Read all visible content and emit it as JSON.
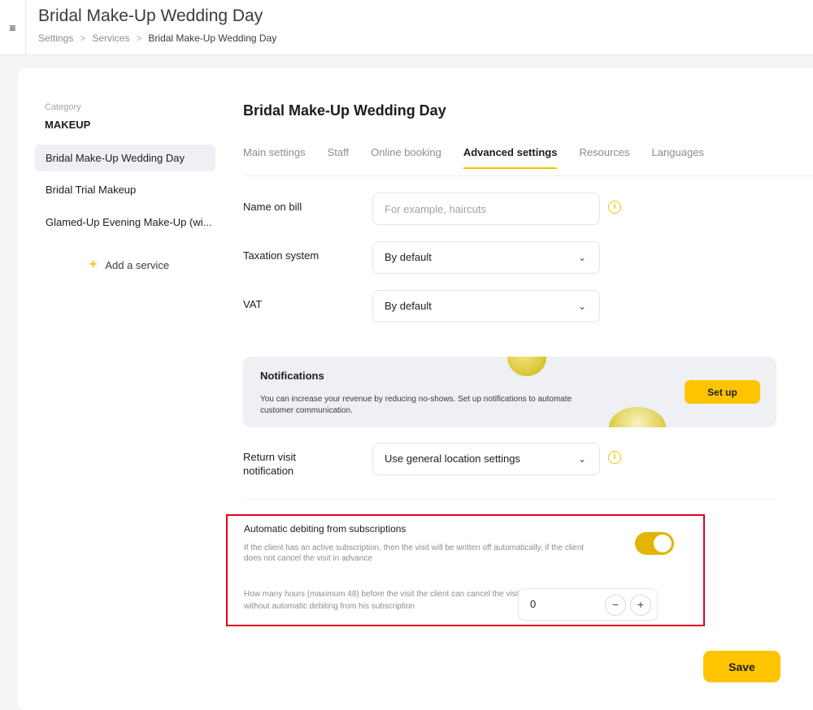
{
  "header": {
    "menu_icon": "hamburger-icon",
    "menu_glyph": "≡",
    "title": "Bridal Make-Up Wedding Day",
    "breadcrumb": [
      {
        "label": "Settings"
      },
      {
        "label": "Services"
      },
      {
        "label": "Bridal Make-Up Wedding Day"
      }
    ],
    "breadcrumb_separator": ">"
  },
  "sidebar": {
    "category_label": "Category",
    "category_name": "MAKEUP",
    "items": [
      {
        "label": "Bridal Make-Up Wedding Day",
        "active": true
      },
      {
        "label": "Bridal Trial Makeup",
        "active": false
      },
      {
        "label": "Glamed-Up Evening Make-Up (wi...",
        "active": false
      }
    ],
    "add_service_label": "Add a service",
    "add_glyph": "+"
  },
  "main": {
    "title": "Bridal Make-Up Wedding Day",
    "tabs": [
      {
        "label": "Main settings",
        "active": false
      },
      {
        "label": "Staff",
        "active": false
      },
      {
        "label": "Online booking",
        "active": false
      },
      {
        "label": "Advanced settings",
        "active": true
      },
      {
        "label": "Resources",
        "active": false
      },
      {
        "label": "Languages",
        "active": false
      }
    ],
    "name_on_bill": {
      "label": "Name on bill",
      "value": "",
      "placeholder": "For example, haircuts"
    },
    "taxation": {
      "label": "Taxation system",
      "value": "By default"
    },
    "vat": {
      "label": "VAT",
      "value": "By default"
    },
    "info_glyph": "i",
    "chevron_glyph": "⌄",
    "notifications": {
      "title": "Notifications",
      "text": "You can increase your revenue by reducing no-shows. Set up notifications to automate customer communication.",
      "button_label": "Set up"
    },
    "return_visit": {
      "label": "Return visit notification",
      "value": "Use general location settings"
    },
    "subscriptions": {
      "title": "Automatic debiting from subscriptions",
      "description": "If the client has an active subscription, then the visit will be written off automatically, if the client does not cancel the visit in advance",
      "toggle_on": true,
      "hours_description": "How many hours (maximum 48) before the visit the client can cancel the visit without automatic debiting from his subscription",
      "hours_value": "0",
      "minus_glyph": "−",
      "plus_glyph": "+"
    },
    "save_label": "Save"
  },
  "colors": {
    "accent": "#ffc400",
    "toggle": "#e3b400",
    "highlight": "#e3001b"
  }
}
